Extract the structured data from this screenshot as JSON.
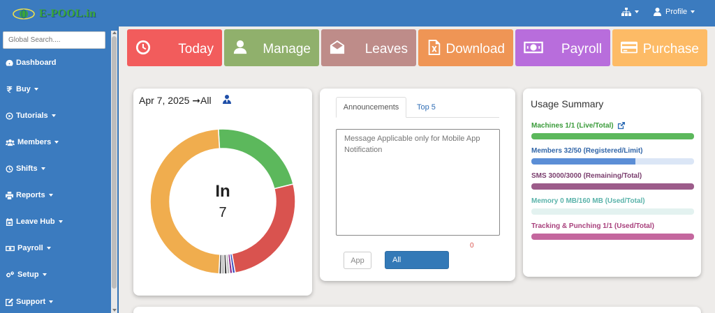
{
  "header": {
    "brand": "E-POOL.in",
    "org_menu_icon": "sitemap-icon",
    "profile_label": "Profile"
  },
  "sidebar": {
    "search_placeholder": "Global Search....",
    "items": [
      {
        "label": "Dashboard",
        "icon": "dashboard-icon"
      },
      {
        "label": "Buy",
        "icon": "rupee-icon"
      },
      {
        "label": "Tutorials",
        "icon": "play-circle-icon"
      },
      {
        "label": "Members",
        "icon": "users-icon"
      },
      {
        "label": "Shifts",
        "icon": "clock-icon"
      },
      {
        "label": "Reports",
        "icon": "print-icon"
      },
      {
        "label": "Leave Hub",
        "icon": "calendar-icon"
      },
      {
        "label": "Payroll",
        "icon": "money-icon"
      },
      {
        "label": "Setup",
        "icon": "cogs-icon"
      },
      {
        "label": "Support",
        "icon": "edit-icon"
      }
    ]
  },
  "tiles": [
    {
      "label": "Today",
      "icon": "clock-icon",
      "color": "#f25c5c"
    },
    {
      "label": "Manage",
      "icon": "user-icon",
      "color": "#90b06c"
    },
    {
      "label": "Leaves",
      "icon": "envelope-open-icon",
      "color": "#be8c89"
    },
    {
      "label": "Download",
      "icon": "excel-file-icon",
      "color": "#ef9555"
    },
    {
      "label": "Payroll",
      "icon": "money-icon",
      "color": "#b86ddc"
    },
    {
      "label": "Purchase",
      "icon": "credit-card-icon",
      "color": "#fdbb66"
    }
  ],
  "attendance": {
    "date": "Apr 7, 2025",
    "arrow": "➞",
    "scope": "All",
    "center_label": "In",
    "center_value": "7",
    "segments": [
      {
        "value": 22,
        "color": "#5cb85c"
      },
      {
        "value": 26,
        "color": "#d9534f"
      },
      {
        "value": 0.6,
        "color": "#3a4fbf"
      },
      {
        "value": 0.6,
        "color": "#8b2a8b"
      },
      {
        "value": 0.6,
        "color": "#bbbbbb"
      },
      {
        "value": 0.6,
        "color": "#444444"
      },
      {
        "value": 0.6,
        "color": "#aaaaaa"
      },
      {
        "value": 0.6,
        "color": "#555555"
      },
      {
        "value": 48,
        "color": "#f0ad4e"
      }
    ]
  },
  "announcements": {
    "tabs": [
      "Announcements",
      "Top 5"
    ],
    "message_placeholder": "Message Applicable only for Mobile App Notification",
    "char_count": "0",
    "app_button": "App",
    "all_button": "All"
  },
  "usage": {
    "title": "Usage Summary",
    "rows": [
      {
        "label": "Machines 1/1 (Live/Total)",
        "color": "#3a9b3a",
        "bar_color": "#5cb85c",
        "track_color": "#dff0d8",
        "fraction": 1.0,
        "link": true
      },
      {
        "label": "Members 32/50 (Registered/Limit)",
        "color": "#3266a8",
        "bar_color": "#5b8ed6",
        "track_color": "#dbe6f6",
        "fraction": 0.64,
        "link": false
      },
      {
        "label": "SMS 3000/3000 (Remaining/Total)",
        "color": "#7a3e6e",
        "bar_color": "#9c5c8a",
        "track_color": "#efe1eb",
        "fraction": 1.0,
        "link": false
      },
      {
        "label": "Memory 0 MB/160 MB (Used/Total)",
        "color": "#5bb3aa",
        "bar_color": "#7cc8bf",
        "track_color": "#e3f2f0",
        "fraction": 0.0,
        "link": false
      },
      {
        "label": "Tracking & Punching 1/1 (Used/Total)",
        "color": "#a8407c",
        "bar_color": "#c4679e",
        "track_color": "#f5e3ee",
        "fraction": 1.0,
        "link": false
      }
    ]
  }
}
